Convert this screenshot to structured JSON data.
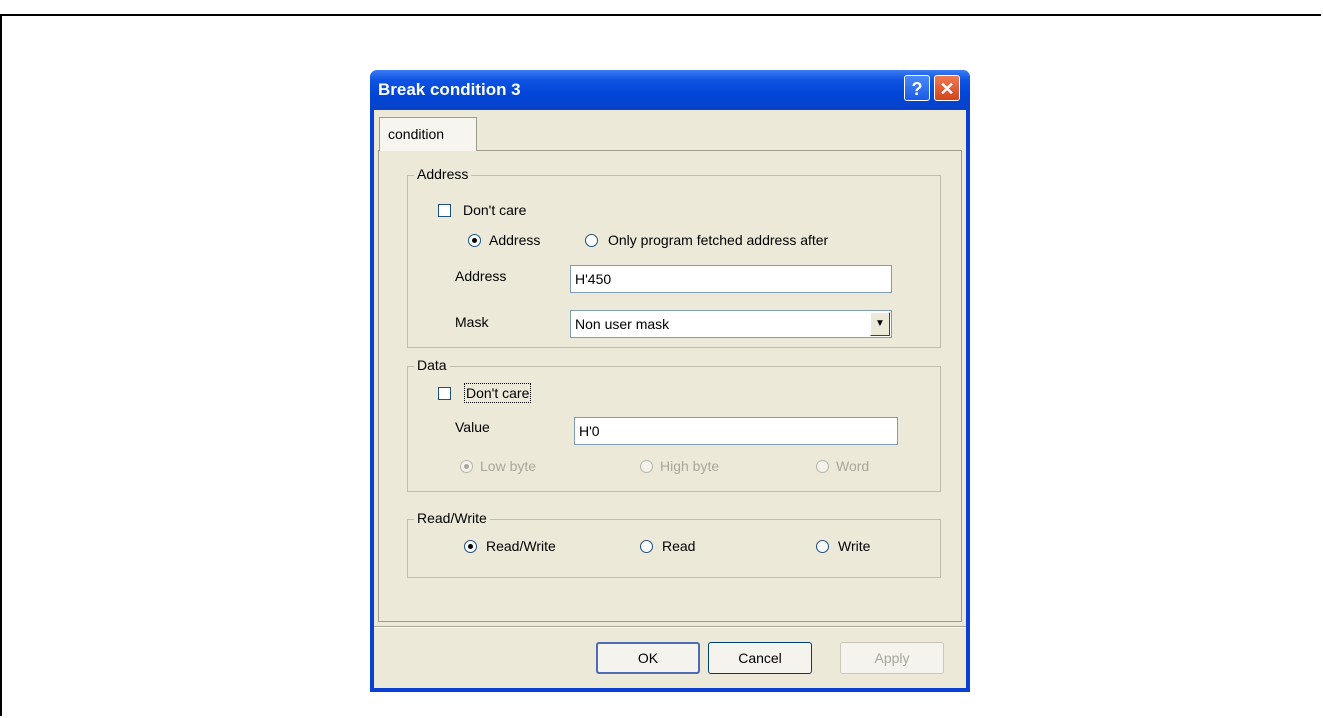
{
  "window": {
    "title": "Break condition 3",
    "help_glyph": "?",
    "close_glyph": "✕"
  },
  "tabs": [
    {
      "label": "condition",
      "selected": true
    }
  ],
  "address_group": {
    "label": "Address",
    "dont_care": {
      "label": "Don't care",
      "checked": false
    },
    "mode_options": [
      {
        "label": "Address",
        "selected": true
      },
      {
        "label": "Only program fetched address after",
        "selected": false
      }
    ],
    "address_label": "Address",
    "address_value": "H'450",
    "mask_label": "Mask",
    "mask_value": "Non user mask"
  },
  "data_group": {
    "label": "Data",
    "dont_care": {
      "label": "Don't care",
      "checked": false
    },
    "value_label": "Value",
    "value": "H'0",
    "size_options": [
      {
        "label": "Low byte",
        "selected": true,
        "enabled": false
      },
      {
        "label": "High byte",
        "selected": false,
        "enabled": false
      },
      {
        "label": "Word",
        "selected": false,
        "enabled": false
      }
    ]
  },
  "rw_group": {
    "label": "Read/Write",
    "options": [
      {
        "label": "Read/Write",
        "selected": true
      },
      {
        "label": "Read",
        "selected": false
      },
      {
        "label": "Write",
        "selected": false
      }
    ]
  },
  "buttons": {
    "ok": "OK",
    "cancel": "Cancel",
    "apply": "Apply"
  },
  "icons": {
    "dropdown": "chevron-down-icon"
  },
  "colors": {
    "titlebar": "#0054e3",
    "client": "#ece9d8",
    "close": "#e0562b"
  }
}
